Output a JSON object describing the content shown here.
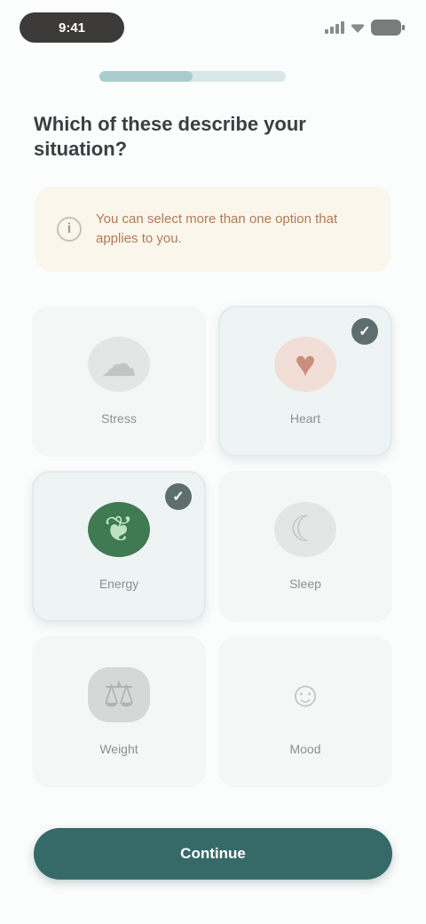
{
  "status_bar": {
    "time": "9:41"
  },
  "onboarding": {
    "progress": 0.5,
    "question": "Which of these describe your situation?",
    "info_text": "You can select more than one option that applies to you."
  },
  "options": [
    {
      "label": "Stress",
      "selected": false,
      "icon": "cloud-icon",
      "color": "#c2c5c6"
    },
    {
      "label": "Heart",
      "selected": true,
      "icon": "heart-icon",
      "color": "#c98f7c"
    },
    {
      "label": "Energy",
      "selected": true,
      "icon": "leaf-icon",
      "color": "#3f7a52"
    },
    {
      "label": "Sleep",
      "selected": false,
      "icon": "moon-icon",
      "color": "#c2c5c6"
    },
    {
      "label": "Weight",
      "selected": false,
      "icon": "scale-icon",
      "color": "#b9bcbd"
    },
    {
      "label": "Mood",
      "selected": false,
      "icon": "smile-icon",
      "color": "#c2c5c6"
    }
  ],
  "continue_label": "Continue",
  "colors": {
    "accent": "#366a69",
    "banner_bg": "#fbf6ec",
    "banner_text": "#b07a55"
  }
}
